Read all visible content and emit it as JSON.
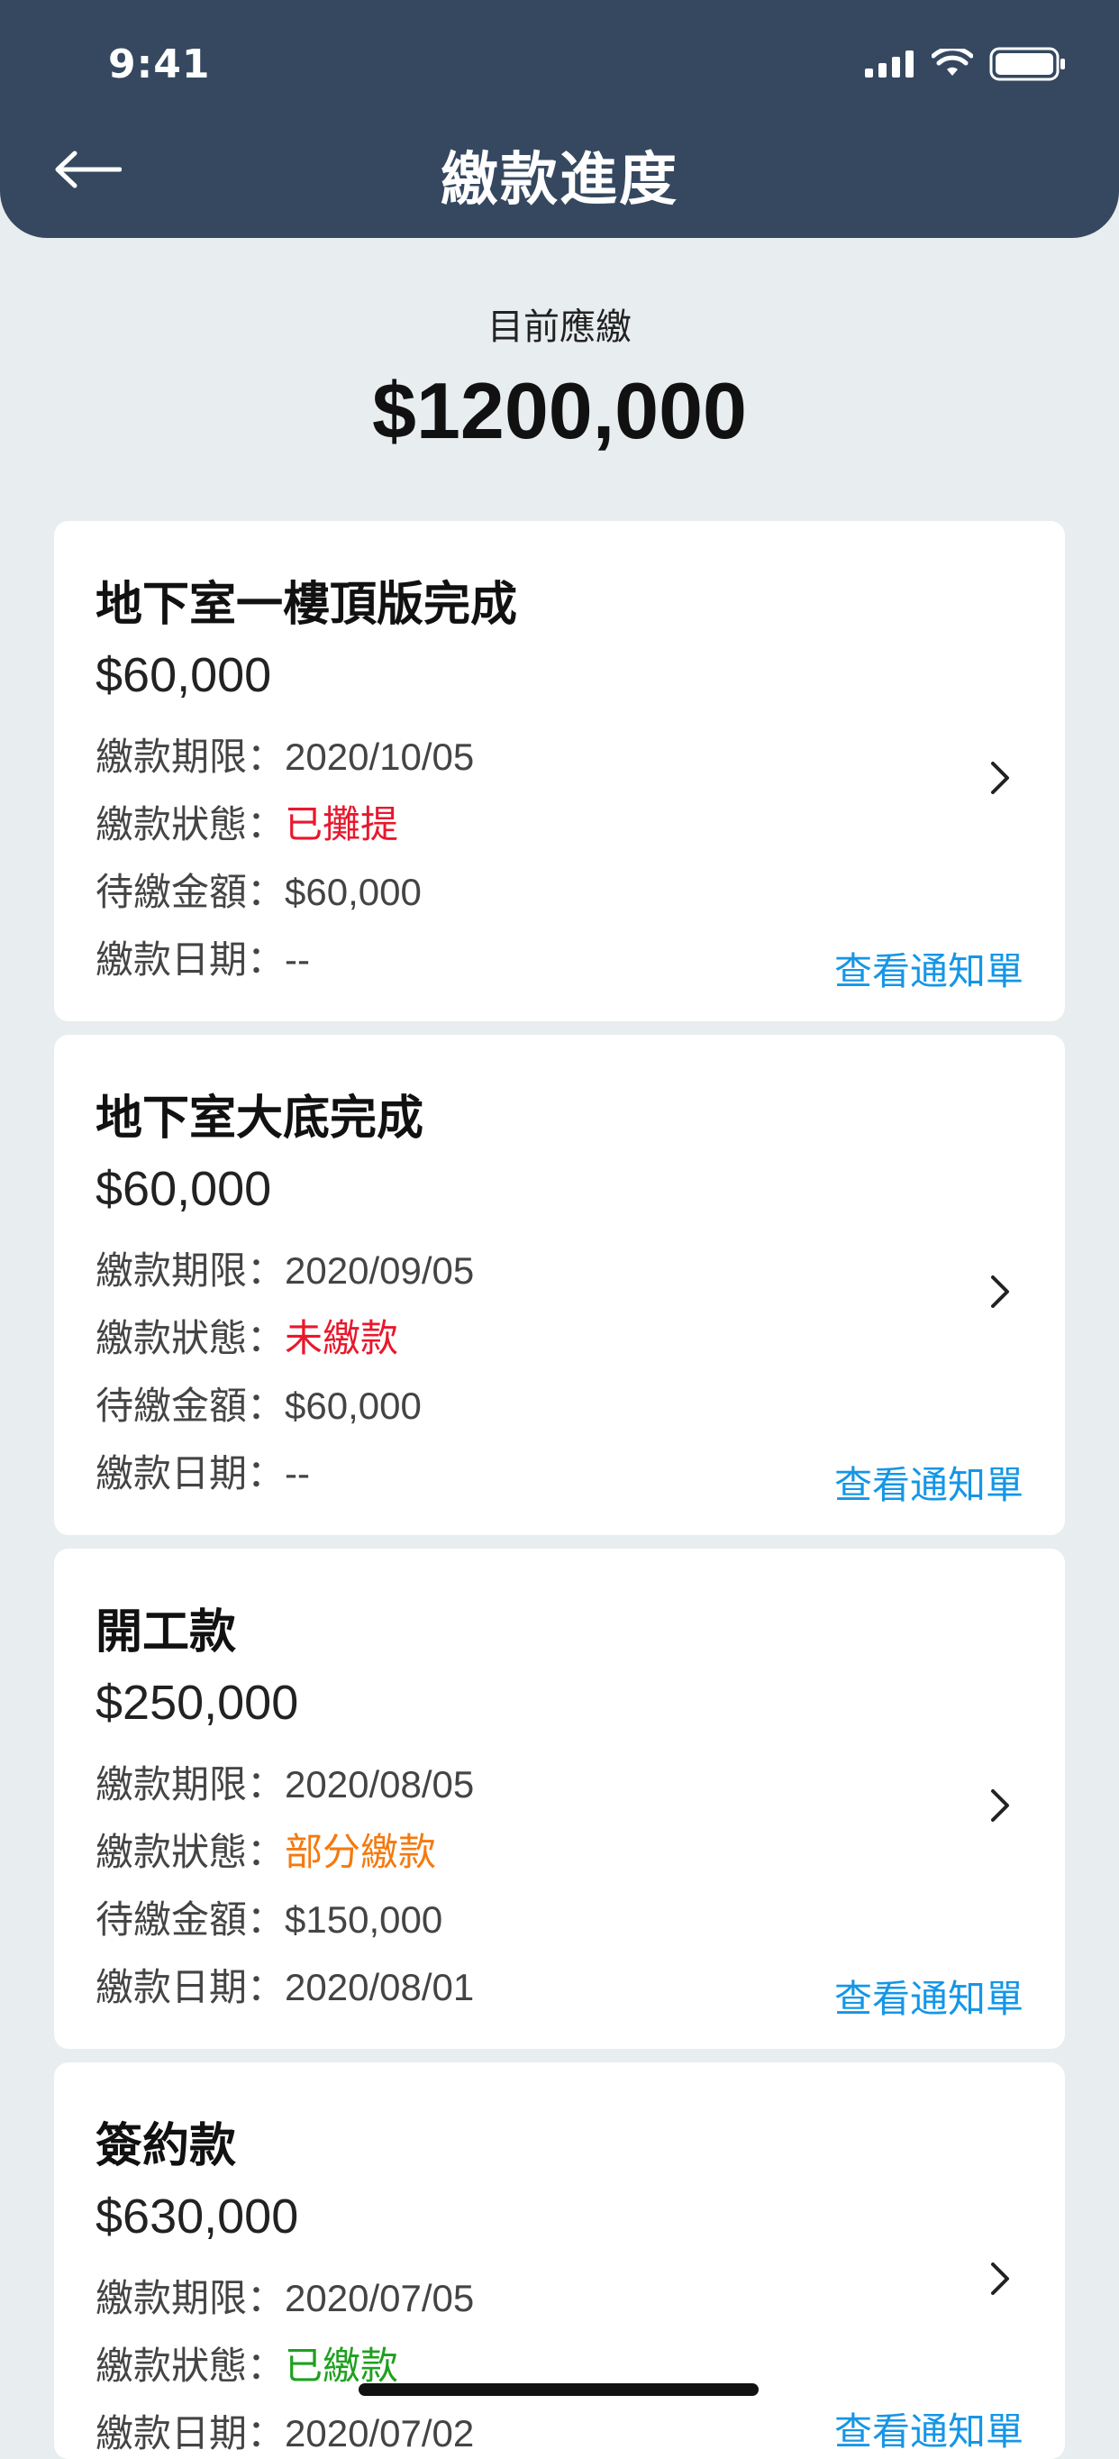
{
  "status_bar": {
    "time": "9:41"
  },
  "header": {
    "title": "繳款進度",
    "back_icon": "arrow-left-icon"
  },
  "summary": {
    "label": "目前應繳",
    "amount": "$1200,000"
  },
  "labels": {
    "deadline": "繳款期限：",
    "status": "繳款狀態：",
    "pending_amount": "待繳金額：",
    "pay_date": "繳款日期：",
    "view_notice": "查看通知單"
  },
  "colors": {
    "header_bg": "#354860",
    "page_bg": "#e8edef",
    "link": "#1596e6",
    "status_red": "#e8182d",
    "status_orange": "#f47a10",
    "status_green": "#1fa020"
  },
  "payments": [
    {
      "title": "地下室一樓頂版完成",
      "amount": "$60,000",
      "deadline": "2020/10/05",
      "status": "已攤提",
      "pending_amount": "$60,000",
      "pay_date": "--"
    },
    {
      "title": "地下室大底完成",
      "amount": "$60,000",
      "deadline": "2020/09/05",
      "status": "未繳款",
      "pending_amount": "$60,000",
      "pay_date": "--"
    },
    {
      "title": "開工款",
      "amount": "$250,000",
      "deadline": "2020/08/05",
      "status": "部分繳款",
      "pending_amount": "$150,000",
      "pay_date": "2020/08/01"
    },
    {
      "title": "簽約款",
      "amount": "$630,000",
      "deadline": "2020/07/05",
      "status": "已繳款",
      "pay_date": "2020/07/02"
    }
  ]
}
